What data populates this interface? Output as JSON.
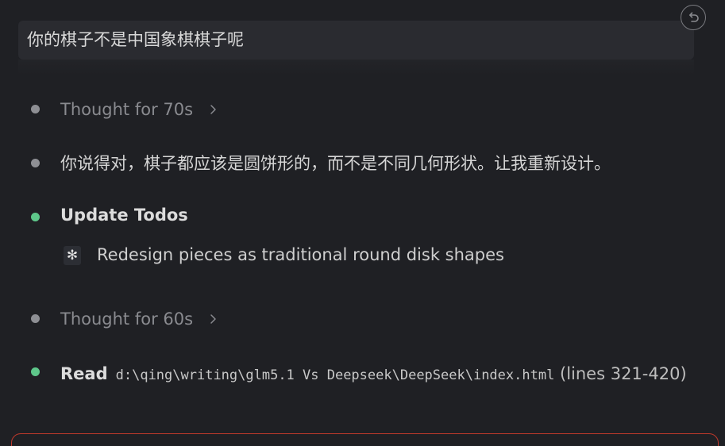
{
  "user_message": {
    "text": "你的棋子不是中国象棋棋子呢"
  },
  "revert_button": {
    "icon": "undo-icon"
  },
  "steps": {
    "thought_1": "Thought for 70s",
    "reply": "你说得对，棋子都应该是圆饼形的，而不是不同几何形状。让我重新设计。",
    "update_todos_title": "Update Todos",
    "todo_item_marker": "✻",
    "todo_item": "Redesign pieces as traditional round disk shapes",
    "thought_2": "Thought for 60s",
    "read_label": "Read",
    "read_path": "d:\\qing\\writing\\glm5.1 Vs Deepseek\\DeepSeek\\index.html",
    "read_range": "(lines 321-420)"
  },
  "colors": {
    "background": "#1f2024",
    "bullet_gray": "#8e8f94",
    "bullet_green": "#5ec78a",
    "alert_border": "#c0392b"
  }
}
